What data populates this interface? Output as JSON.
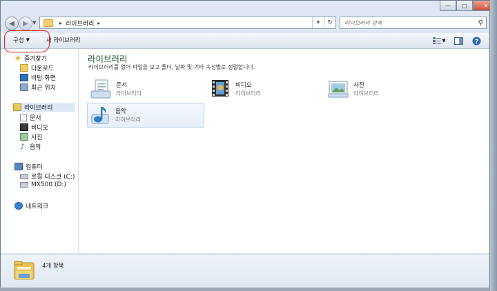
{
  "window": {
    "controls": {
      "minimize": "—",
      "maximize": "□",
      "close": "✕"
    }
  },
  "nav": {
    "back_icon": "arrow-left-icon",
    "forward_icon": "arrow-right-icon",
    "breadcrumb": [
      "라이브러리"
    ],
    "search_placeholder": "라이브러리 검색"
  },
  "toolbar": {
    "organize": "구성",
    "new_library": "새 라이브러리"
  },
  "sidebar": {
    "favorites": {
      "label": "즐겨찾기",
      "items": [
        "다운로드",
        "바탕 화면",
        "최근 위치"
      ]
    },
    "libraries": {
      "label": "라이브러리",
      "items": [
        "문서",
        "비디오",
        "사진",
        "음악"
      ]
    },
    "computer": {
      "label": "컴퓨터",
      "items": [
        "로컬 디스크 (C:)",
        "MX500 (D:)"
      ]
    },
    "network": {
      "label": "네트워크"
    }
  },
  "main": {
    "title": "라이브러리",
    "subtitle": "라이브러리를 열어 파일을 보고 폴더, 날짜 및 기타 속성별로 정렬합니다.",
    "libraries": [
      {
        "name": "문서",
        "type": "라이브러리"
      },
      {
        "name": "비디오",
        "type": "라이브러리"
      },
      {
        "name": "사진",
        "type": "라이브러리"
      },
      {
        "name": "음악",
        "type": "라이브러리"
      }
    ]
  },
  "status": {
    "count": "4개 항목"
  },
  "colors": {
    "title_green": "#1e5a2b",
    "annotation_red": "#e01c1c",
    "selection_blue": "#dbe8f6"
  }
}
